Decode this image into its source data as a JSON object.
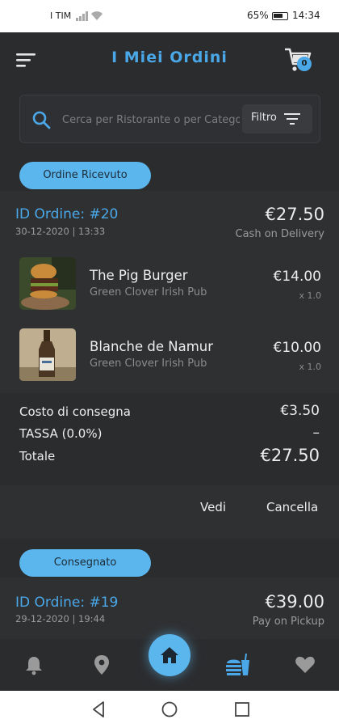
{
  "status_bar": {
    "carrier": "I TIM",
    "battery": "65%",
    "time": "14:34"
  },
  "header": {
    "title": "I Miei Ordini",
    "cart_count": "0"
  },
  "search": {
    "placeholder": "Cerca per Ristorante o per Categoria",
    "filter_label": "Filtro"
  },
  "orders": [
    {
      "status": "Ordine Ricevuto",
      "id_label": "ID Ordine: #20",
      "date": "30-12-2020 | 13:33",
      "total": "€27.50",
      "payment": "Cash on Delivery",
      "items": [
        {
          "name": "The Pig Burger",
          "restaurant": "Green Clover Irish Pub",
          "price": "€14.00",
          "qty": "x 1.0",
          "image": "burger-photo"
        },
        {
          "name": "Blanche de Namur",
          "restaurant": "Green Clover Irish Pub",
          "price": "€10.00",
          "qty": "x 1.0",
          "image": "beer-bottle-photo"
        }
      ],
      "summary": {
        "delivery_label": "Costo di consegna",
        "delivery_value": "€3.50",
        "tax_label": "TASSA (0.0%)",
        "tax_value": "–",
        "total_label": "Totale",
        "total_value": "€27.50"
      },
      "actions": {
        "view": "Vedi",
        "cancel": "Cancella"
      }
    },
    {
      "status": "Consegnato",
      "id_label": "ID Ordine: #19",
      "date": "29-12-2020 | 19:44",
      "total": "€39.00",
      "payment": "Pay on Pickup"
    }
  ],
  "bottom_nav": [
    {
      "name": "notifications",
      "icon": "bell-icon"
    },
    {
      "name": "location",
      "icon": "map-pin-icon"
    },
    {
      "name": "home",
      "icon": "home-icon"
    },
    {
      "name": "food-menu",
      "icon": "burger-drink-icon"
    },
    {
      "name": "favorites",
      "icon": "heart-icon"
    }
  ],
  "colors": {
    "accent": "#4aa8e8",
    "pill": "#5bb6ee",
    "background": "#2b2c2e",
    "card": "#2f3032"
  }
}
